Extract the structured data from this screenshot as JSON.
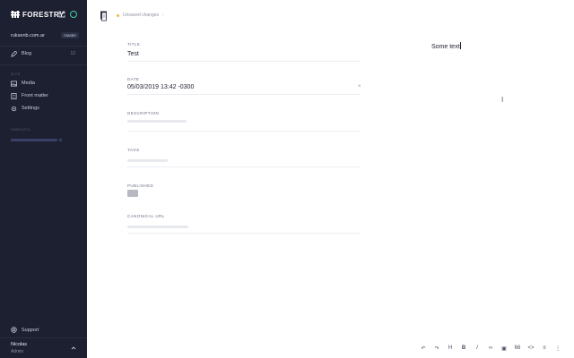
{
  "sidebar": {
    "brand": "FORESTRY",
    "site_url": "ruksenb.com.ar",
    "branch": "master",
    "main_item": {
      "label": "Blog",
      "count": "12"
    },
    "site_section_label": "SITE",
    "site_items": [
      {
        "label": "Media",
        "icon": "image-icon"
      },
      {
        "label": "Front matter",
        "icon": "document-icon"
      },
      {
        "label": "Settings",
        "icon": "gear-icon"
      }
    ],
    "recent_section_label": "CMS/UTIL",
    "support_label": "Support",
    "user": {
      "name": "Nicolas",
      "role": "Admin"
    }
  },
  "topbar": {
    "status_text": "Unsaved changes",
    "status_color": "#f5b13d"
  },
  "form": {
    "fields": [
      {
        "label": "TITLE",
        "value": "Test"
      },
      {
        "label": "DATE",
        "value": "05/03/2019 13:42 -0300"
      },
      {
        "label": "DESCRIPTION",
        "value": ""
      },
      {
        "label": "TAGS",
        "value": ""
      },
      {
        "label": "PUBLISHED",
        "value": ""
      },
      {
        "label": "CANONICAL URL",
        "value": ""
      }
    ],
    "date_clear_symbol": "×"
  },
  "preview": {
    "text": "Some text"
  },
  "editor_toolbar": [
    {
      "name": "undo-icon",
      "glyph": "↶"
    },
    {
      "name": "redo-icon",
      "glyph": "↷"
    },
    {
      "name": "heading-icon",
      "glyph": "H"
    },
    {
      "name": "bold-icon",
      "glyph": "B"
    },
    {
      "name": "italic-icon",
      "glyph": "I"
    },
    {
      "name": "link-icon",
      "glyph": "∞"
    },
    {
      "name": "image-icon",
      "glyph": "▣"
    },
    {
      "name": "quote-icon",
      "glyph": "66"
    },
    {
      "name": "code-icon",
      "glyph": "<>"
    },
    {
      "name": "bullet-list-icon",
      "glyph": "≡"
    },
    {
      "name": "numbered-list-icon",
      "glyph": "⋮"
    }
  ],
  "colors": {
    "sidebar_bg": "#1d2031",
    "accent_green": "#3fd1a0",
    "unsaved_dot": "#f5b13d"
  }
}
